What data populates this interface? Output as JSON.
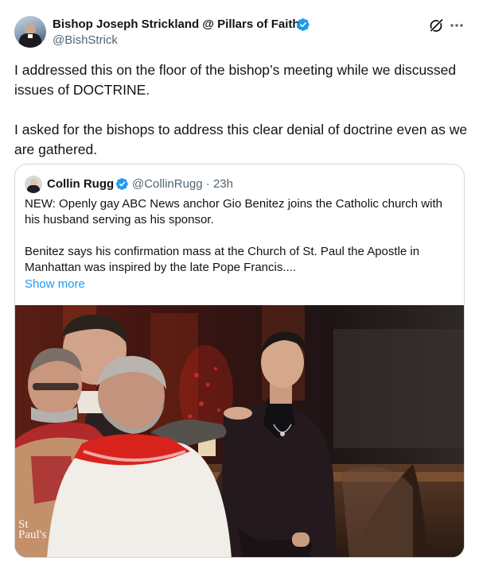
{
  "post": {
    "author_name": "Bishop Joseph Strickland @ Pillars of Faith",
    "author_handle": "@BishStrick",
    "paragraphs": [
      "I addressed this on the floor of the bishop’s meeting while we discussed issues of DOCTRINE.",
      "I asked for the bishops to address this clear denial of doctrine even as we are gathered."
    ],
    "icons": [
      "avatar",
      "verified-badge-icon",
      "grok-icon",
      "more-options-icon"
    ]
  },
  "quoted_post": {
    "author_name": "Collin Rugg",
    "author_handle": "@CollinRugg",
    "separator": "·",
    "timestamp": "23h",
    "paragraphs": [
      "NEW: Openly gay ABC News anchor Gio Benitez joins the Catholic church with his husband serving as his sponsor.",
      "Benitez says his confirmation mass at the Church of St. Paul the Apostle in Manhattan was inspired by the late Pope Francis...."
    ],
    "show_more_label": "Show more",
    "media": {
      "description_icon": "photo",
      "watermark_lines": [
        "St",
        "Paul's"
      ]
    }
  },
  "colors": {
    "text_primary": "#0f1419",
    "text_secondary": "#536471",
    "link": "#1d9bf0",
    "verified_badge": "#1d9bf0",
    "border": "#cfd9de",
    "vestment_red": "#c8231e"
  }
}
